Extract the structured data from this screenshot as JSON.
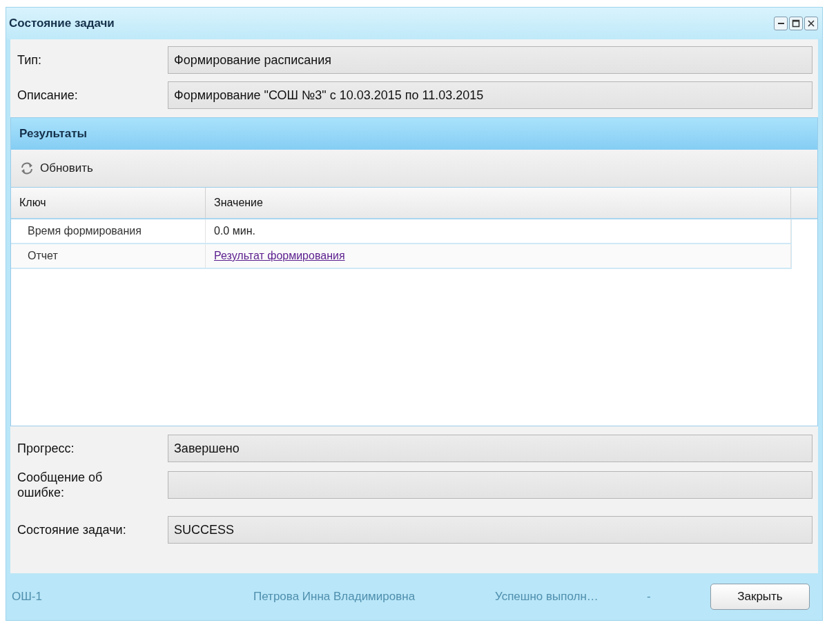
{
  "window": {
    "title": "Состояние задачи"
  },
  "fields_top": [
    {
      "label": "Тип:",
      "value": "Формирование расписания"
    },
    {
      "label": "Описание:",
      "value": "Формирование \"СОШ №3\" с 10.03.2015 по 11.03.2015"
    }
  ],
  "results": {
    "title": "Результаты",
    "toolbar": {
      "refresh_label": "Обновить"
    },
    "table": {
      "columns": [
        "Ключ",
        "Значение"
      ],
      "rows": [
        {
          "key": "Время формирования",
          "value": "0.0 мин.",
          "kind": "text"
        },
        {
          "key": "Отчет",
          "value": "Результат формирования",
          "kind": "link"
        }
      ]
    }
  },
  "fields_bottom": [
    {
      "label": "Прогресс:",
      "value": "Завершено"
    },
    {
      "label": "Сообщение об ошибке:"
    },
    {
      "label": "Состояние задачи:",
      "value": "SUCCESS"
    }
  ],
  "background_row": [
    "ОШ-1",
    "Петрова Инна Владимировна",
    "Успешно выполн…",
    "-"
  ],
  "buttons": {
    "close": "Закрыть"
  }
}
